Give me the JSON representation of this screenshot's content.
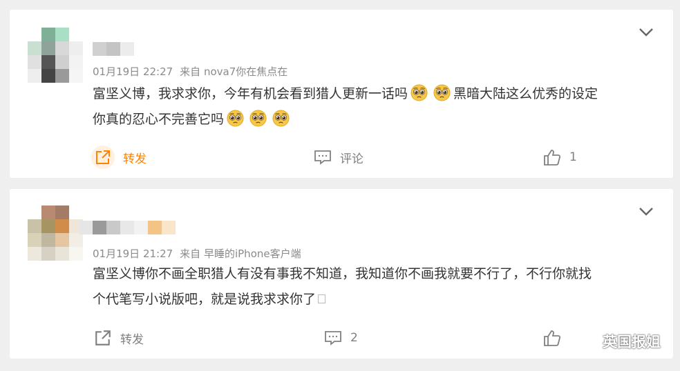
{
  "comments": [
    {
      "avatar_colors": [
        "#ffffff",
        "#7faf96",
        "#a8dfc5",
        "#ffffff",
        "#c8dfd2",
        "#8fa39a",
        "#d8d8d8",
        "#eeeeee",
        "#e0e0e0",
        "#555555",
        "#cfcfcf",
        "#f3f3f3",
        "#eeeeee",
        "#444444",
        "#9a9a9a",
        "#f5f5f5"
      ],
      "name_colors": [
        "#d0d0d0",
        "#c4c4c4",
        "#ececec"
      ],
      "timestamp": "01月19日 22:27",
      "source_prefix": "来自",
      "source": "nova7你在焦点在",
      "text_line1": "富坚义博，我求求你，今年有机会看到猎人更新一话吗",
      "text_line1_tail": "黑暗大陆这么优秀的设定",
      "text_line2": "你真的忍心不完善它吗",
      "emoji_name": "pleading-face",
      "repost_label": "转发",
      "comment_label": "评论",
      "like_count": "1"
    },
    {
      "avatar_colors": [
        "#ffffff",
        "#b88a72",
        "#a37b66",
        "#ffffff",
        "#c9c2a9",
        "#a69463",
        "#d28c4a",
        "#efe6d8",
        "#d8d2b8",
        "#bfb7a0",
        "#e4c6a3",
        "#f2eee6",
        "#ece8dd",
        "#d6d1c3",
        "#e9e4d8",
        "#f8f6f1"
      ],
      "name_colors": [
        "#e6e6e6",
        "#9a9a9a",
        "#c9c9c9",
        "#e8e8e8",
        "#f2f2f2",
        "#f3c486",
        "#f9e5c9"
      ],
      "timestamp": "01月19日 21:27",
      "source_prefix": "来自",
      "source": "早睡的iPhone客户端",
      "text_line1": "富坚义博你不画全职猎人有没有事我不知道，我知道你不画我就要不行了，不行你就找",
      "text_line2": "个代笔写小说版吧，就是说我求求你了",
      "repost_label": "转发",
      "comment_count": "2"
    }
  ],
  "watermark": "英国报姐",
  "colors": {
    "accent": "#ff8200",
    "text": "#333333",
    "meta": "#8a8a8a",
    "background": "#efefef"
  }
}
